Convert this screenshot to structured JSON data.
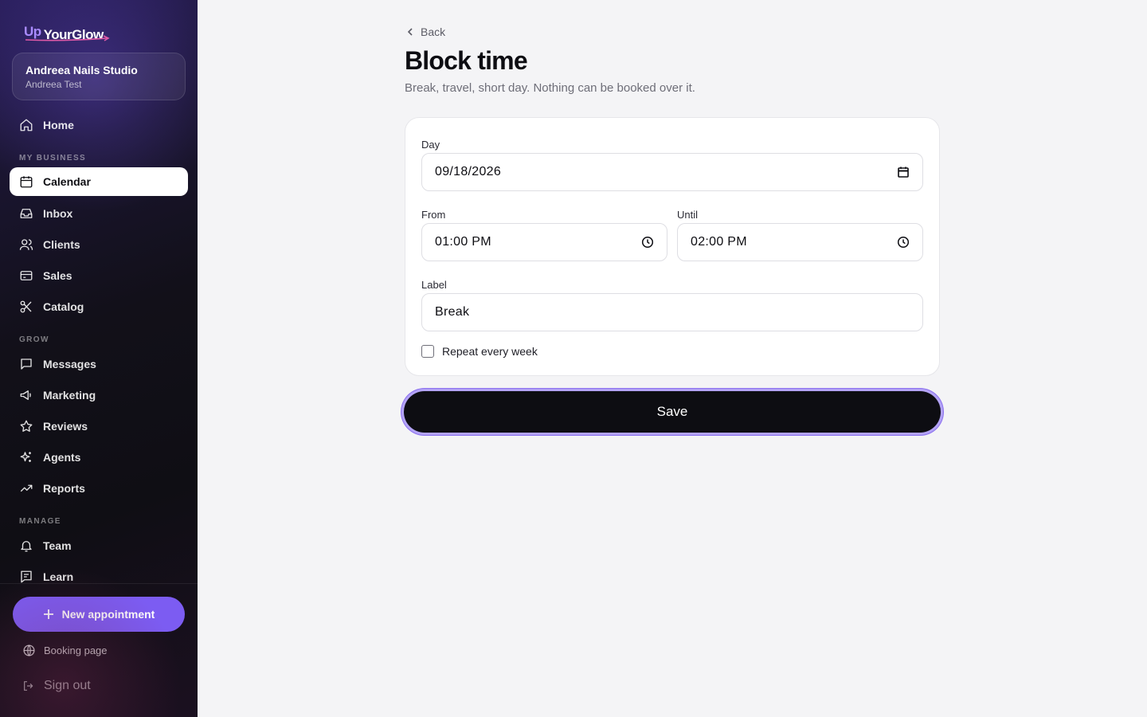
{
  "brand": {
    "prefix": "Up",
    "name": "YourGlow"
  },
  "studio": {
    "name": "Andreea Nails Studio",
    "owner": "Andreea Test"
  },
  "nav": {
    "home": "Home",
    "sections": {
      "my_business": "MY BUSINESS",
      "grow": "GROW",
      "manage": "MANAGE"
    },
    "items": {
      "calendar": "Calendar",
      "inbox": "Inbox",
      "clients": "Clients",
      "sales": "Sales",
      "catalog": "Catalog",
      "messages": "Messages",
      "marketing": "Marketing",
      "reviews": "Reviews",
      "agents": "Agents",
      "reports": "Reports",
      "team": "Team",
      "learn": "Learn"
    },
    "active": "calendar"
  },
  "sidebar_actions": {
    "new_appointment": "New appointment",
    "booking_page": "Booking page",
    "sign_out": "Sign out"
  },
  "page": {
    "back": "Back",
    "title": "Block time",
    "subtitle": "Break, travel, short day. Nothing can be booked over it."
  },
  "form": {
    "day": {
      "label": "Day",
      "value": "09/18/2026"
    },
    "from": {
      "label": "From",
      "value": "01:00 PM"
    },
    "until": {
      "label": "Until",
      "value": "02:00 PM"
    },
    "label": {
      "label": "Label",
      "value": "Break"
    },
    "repeat": {
      "label": "Repeat every week",
      "checked": false
    },
    "save": "Save"
  },
  "colors": {
    "accent": "#7c5cf2",
    "primary_button": "#0d0d12",
    "background": "#f4f4f6"
  }
}
